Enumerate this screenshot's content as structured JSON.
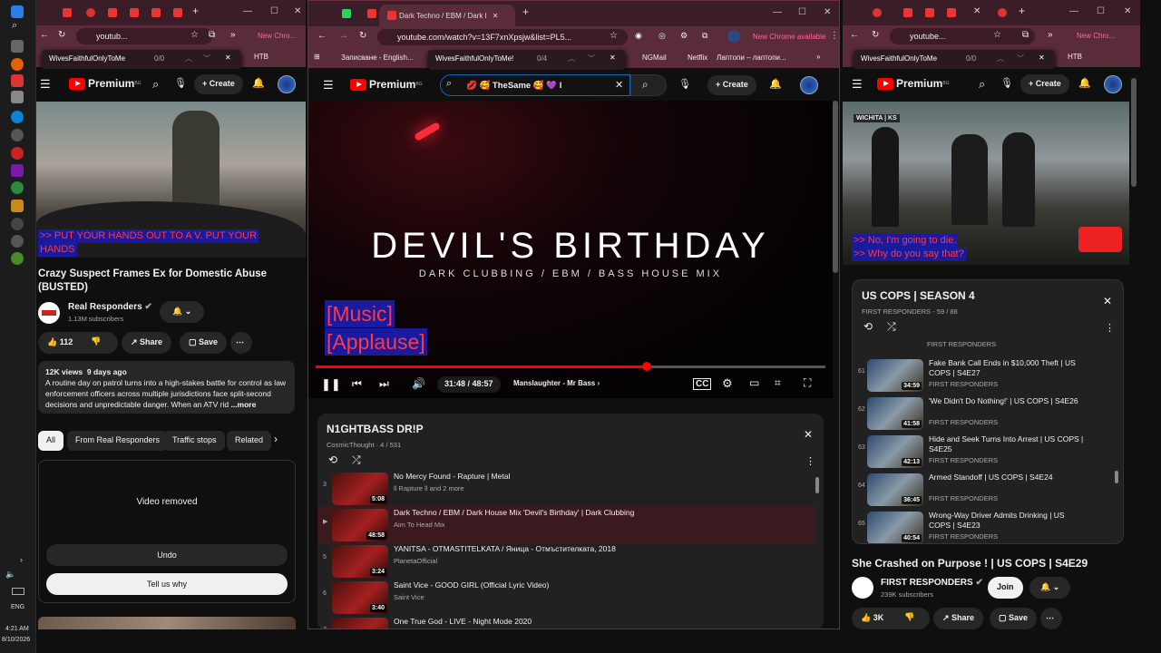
{
  "taskbar": {
    "time": "4:21 AM",
    "date": "8/10/2026",
    "lang": "ENG"
  },
  "left": {
    "tab_title": "youtub...",
    "new_chrome": "New Chro...",
    "bookmark": "НТВ",
    "find": {
      "query": "WivesFaithfulOnlyToMe",
      "count": "0/0"
    },
    "premium": "Premium",
    "badge": "BG",
    "create": "Create",
    "captions": [
      ">> PUT YOUR HANDS OUT TO A V. PUT YOUR",
      "HANDS"
    ],
    "title": "Crazy Suspect Frames Ex for Domestic Abuse (BUSTED)",
    "channel": "Real Responders",
    "subs": "1.13M subscribers",
    "likes": "112",
    "share": "Share",
    "save": "Save",
    "views": "12K views",
    "ago": "9 days ago",
    "description": "A routine day on patrol turns into a high-stakes battle for control as law enforcement officers across multiple jurisdictions face split-second decisions and unpredictable danger. When an ATV rid",
    "more": "...more",
    "chips": [
      "All",
      "From Real Responders",
      "Traffic stops",
      "Related"
    ],
    "removed": "Video removed",
    "undo": "Undo",
    "tell": "Tell us why"
  },
  "center": {
    "tab_title": "Dark Techno / EBM / Dark I",
    "url": "youtube.com/watch?v=13F7xnXpsjw&list=PL5...",
    "new_chrome": "New Chrome available",
    "bookmarks": [
      "Записване - English...",
      "NGMail",
      "Netflix",
      "Лаптопи – лаптопи..."
    ],
    "find": {
      "query": "WivesFaithfulOnlyToMe!",
      "count": "0/4"
    },
    "premium": "Premium",
    "badge": "BG",
    "create": "Create",
    "search": "💋 🥰 TheSame 🥰 💜 l",
    "video_title": "DEVIL'S BIRTHDAY",
    "video_sub": "DARK CLUBBING / EBM / BASS HOUSE MIX",
    "captions": [
      "[Music]",
      "[Applause]"
    ],
    "time": "31:48 / 48:57",
    "chapter": "Manslaughter - Mr Bass",
    "progress": 0.65,
    "playlist": {
      "title": "N1GHTBASS DR!P",
      "meta": "CosmicThought · 4 / 531",
      "items": [
        {
          "n": "3",
          "title": "No Mercy Found - Rapture | Metal",
          "sub": "ll Rapture ll and 2 more",
          "dur": "5:08"
        },
        {
          "n": "▶",
          "title": "Dark Techno / EBM / Dark House Mix 'Devil's Birthday' | Dark Clubbing",
          "sub": "Aim To Head Mix",
          "dur": "48:58"
        },
        {
          "n": "5",
          "title": "YANITSA - OTMASTITELKATA / Яница - Отмъстителката, 2018",
          "sub": "PlanetaOfficial",
          "dur": "3:24"
        },
        {
          "n": "6",
          "title": "Saint Vice - GOOD GIRL (Official Lyric Video)",
          "sub": "Saint Vice",
          "dur": "3:40"
        },
        {
          "n": "7",
          "title": "One True God - LIVE - Night Mode 2020",
          "sub": "",
          "dur": ""
        }
      ]
    }
  },
  "right": {
    "tab_title": "youtube...",
    "new_chrome": "New Chro...",
    "bookmark": "НТВ",
    "find": {
      "query": "WivesFaithfulOnlyToMe",
      "count": "0/0"
    },
    "premium": "Premium",
    "badge": "BG",
    "create": "Create",
    "location": "WICHITA | KS",
    "captions": [
      ">> No, I'm going to die.",
      ">> Why do you say that?"
    ],
    "playlist": {
      "title": "US COPS | SEASON 4",
      "meta": "FIRST RESPONDERS - 59 / 88",
      "top_channel": "FIRST RESPONDERS",
      "items": [
        {
          "n": "61",
          "title": "Fake Bank Call Ends in $10,000 Theft | US COPS | S4E27",
          "sub": "FIRST RESPONDERS",
          "dur": "34:59"
        },
        {
          "n": "62",
          "title": "'We Didn't Do Nothing!' | US COPS | S4E26",
          "sub": "FIRST RESPONDERS",
          "dur": "41:58"
        },
        {
          "n": "63",
          "title": "Hide and Seek Turns Into Arrest | US COPS | S4E25",
          "sub": "FIRST RESPONDERS",
          "dur": "42:13"
        },
        {
          "n": "64",
          "title": "Armed Standoff | US COPS | S4E24",
          "sub": "FIRST RESPONDERS",
          "dur": "36:45"
        },
        {
          "n": "65",
          "title": "Wrong-Way Driver Admits Drinking | US COPS | S4E23",
          "sub": "FIRST RESPONDERS",
          "dur": "40:54"
        }
      ]
    },
    "title": "She Crashed on Purpose ! | US COPS | S4E29",
    "channel": "FIRST RESPONDERS",
    "subs": "239K subscribers",
    "join": "Join",
    "likes": "3K",
    "share": "Share",
    "save": "Save"
  }
}
